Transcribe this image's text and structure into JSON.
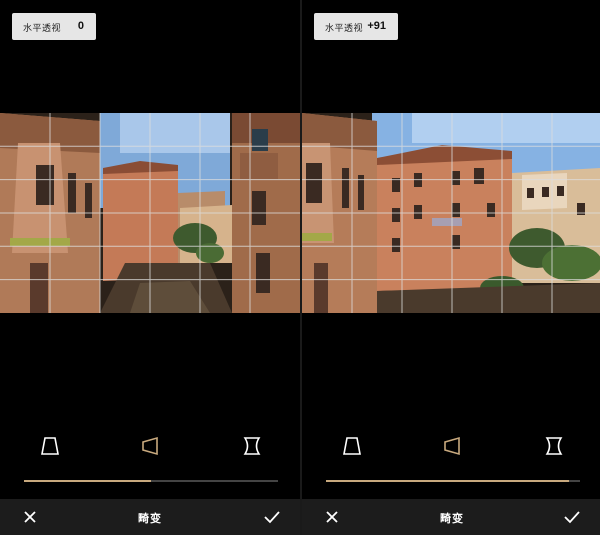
{
  "panels": [
    {
      "adjustment": {
        "label": "水平透视",
        "value": "0"
      },
      "slider_fraction": 0.5,
      "tools": {
        "vertical": "trapezoid-vertical-icon",
        "horizontal": "trapezoid-horizontal-icon",
        "distort": "hourglass-icon"
      },
      "bottom": {
        "title": "畸变",
        "cancel": "close-icon",
        "confirm": "check-icon"
      }
    },
    {
      "adjustment": {
        "label": "水平透视",
        "value": "+91"
      },
      "slider_fraction": 0.955,
      "tools": {
        "vertical": "trapezoid-vertical-icon",
        "horizontal": "trapezoid-horizontal-icon",
        "distort": "hourglass-icon"
      },
      "bottom": {
        "title": "畸变",
        "cancel": "close-icon",
        "confirm": "check-icon"
      }
    }
  ],
  "colors": {
    "accent": "#c8a97e",
    "track": "#444444",
    "bar": "#1c1c1c",
    "badge": "#e6e6e6"
  }
}
